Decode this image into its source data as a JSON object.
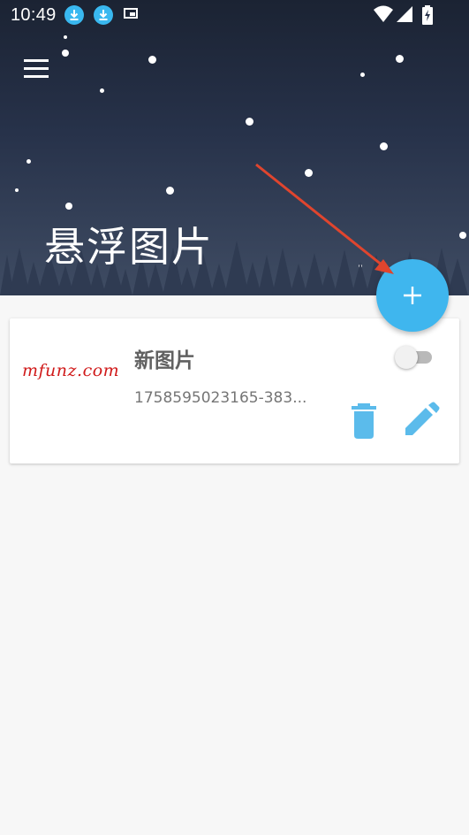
{
  "status_bar": {
    "time": "10:49",
    "icons": [
      "download-icon",
      "download-icon",
      "picture-in-picture-icon",
      "wifi-icon",
      "signal-icon",
      "battery-charging-icon"
    ]
  },
  "header": {
    "menu_icon": "menu-icon",
    "title": "悬浮图片"
  },
  "fab": {
    "icon": "plus-icon",
    "color": "#3fb6ee"
  },
  "list": {
    "items": [
      {
        "thumbnail_text": "mfunz.com",
        "title": "新图片",
        "subtitle": "1758595023165-383...",
        "toggle_on": false,
        "actions": [
          "delete-icon",
          "edit-icon"
        ]
      }
    ]
  },
  "colors": {
    "accent": "#3fb6ee",
    "action_icons": "#5bbbeb",
    "annotation_arrow": "#e0452e",
    "background": "#f7f7f7"
  }
}
